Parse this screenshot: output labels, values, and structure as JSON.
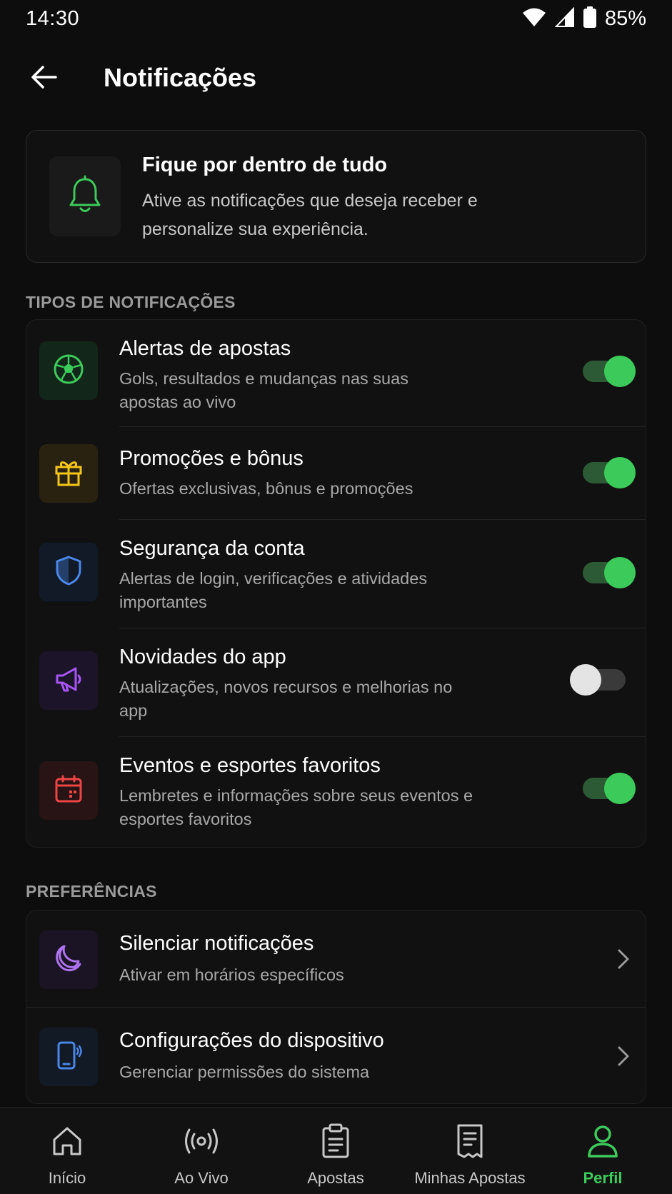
{
  "status_bar": {
    "time": "14:30",
    "battery": "85%"
  },
  "header": {
    "title": "Notificações"
  },
  "info_card": {
    "title": "Fique por dentro de tudo",
    "description": "Ative as notificações que deseja receber e personalize sua experiência."
  },
  "notification_types": {
    "section_label": "TIPOS DE NOTIFICAÇÕES",
    "items": [
      {
        "title": "Alertas de apostas",
        "description": "Gols, resultados e mudanças nas suas apostas ao vivo",
        "enabled": true,
        "icon": "soccer-ball-icon",
        "color": "#3ccb5a"
      },
      {
        "title": "Promoções e bônus",
        "description": "Ofertas exclusivas, bônus e promoções",
        "enabled": true,
        "icon": "gift-icon",
        "color": "#f5c518"
      },
      {
        "title": "Segurança da conta",
        "description": "Alertas de login, verificações e atividades importantes",
        "enabled": true,
        "icon": "shield-icon",
        "color": "#4a86e8"
      },
      {
        "title": "Novidades do app",
        "description": "Atualizações, novos recursos e melhorias no app",
        "enabled": false,
        "icon": "megaphone-icon",
        "color": "#a855f7"
      },
      {
        "title": "Eventos e esportes favoritos",
        "description": "Lembretes e informações sobre seus eventos e esportes favoritos",
        "enabled": true,
        "icon": "calendar-icon",
        "color": "#ef4444"
      }
    ]
  },
  "preferences": {
    "section_label": "PREFERÊNCIAS",
    "items": [
      {
        "title": "Silenciar notificações",
        "description": "Ativar em horários específicos",
        "icon": "moon-icon",
        "color": "#b073f0"
      },
      {
        "title": "Configurações do dispositivo",
        "description": "Gerenciar permissões do sistema",
        "icon": "phone-vibrate-icon",
        "color": "#4a86e8"
      }
    ]
  },
  "bottom_nav": {
    "items": [
      {
        "label": "Início",
        "icon": "home-icon",
        "active": false
      },
      {
        "label": "Ao Vivo",
        "icon": "broadcast-icon",
        "active": false
      },
      {
        "label": "Apostas",
        "icon": "clipboard-icon",
        "active": false
      },
      {
        "label": "Minhas Apostas",
        "icon": "receipt-icon",
        "active": false
      },
      {
        "label": "Perfil",
        "icon": "user-icon",
        "active": true
      }
    ]
  },
  "colors": {
    "accent": "#3ccb5a",
    "background": "#0d0d0d",
    "card": "#111111"
  }
}
